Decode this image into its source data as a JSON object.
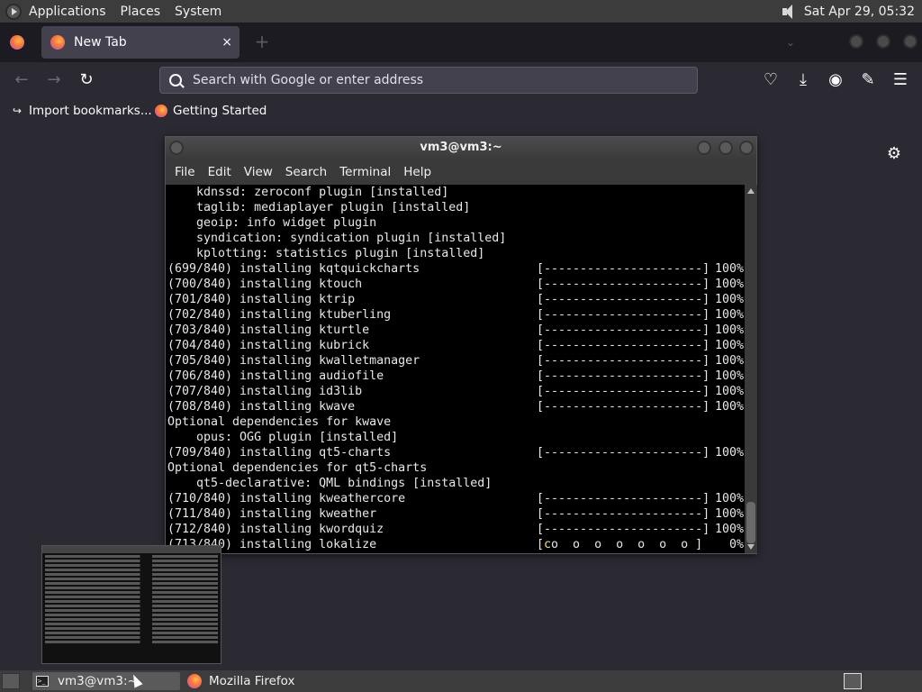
{
  "top_panel": {
    "menus": [
      "Applications",
      "Places",
      "System"
    ],
    "clock": "Sat Apr 29, 05:32"
  },
  "browser": {
    "tab": {
      "label": "New Tab",
      "close": "×"
    },
    "new_tab": "+",
    "url_placeholder": "Search with Google or enter address",
    "bookmarks": [
      "Import bookmarks...",
      "Getting Started"
    ],
    "nav": {
      "back": "←",
      "forward": "→",
      "reload": "↻"
    },
    "toolbar_icons": [
      "pocket-icon",
      "download-icon",
      "account-icon",
      "extensions-icon",
      "menu-icon"
    ]
  },
  "terminal": {
    "title": "vm3@vm3:~",
    "menu": [
      "File",
      "Edit",
      "View",
      "Search",
      "Terminal",
      "Help"
    ],
    "lines": [
      {
        "text": "    kdnssd: zeroconf plugin [installed]"
      },
      {
        "text": "    taglib: mediaplayer plugin [installed]"
      },
      {
        "text": "    geoip: info widget plugin"
      },
      {
        "text": "    syndication: syndication plugin [installed]"
      },
      {
        "text": "    kplotting: statistics plugin [installed]"
      },
      {
        "text": "(699/840) installing kqtquickcharts",
        "bar": "[----------------------]",
        "pct": "100%"
      },
      {
        "text": "(700/840) installing ktouch",
        "bar": "[----------------------]",
        "pct": "100%"
      },
      {
        "text": "(701/840) installing ktrip",
        "bar": "[----------------------]",
        "pct": "100%"
      },
      {
        "text": "(702/840) installing ktuberling",
        "bar": "[----------------------]",
        "pct": "100%"
      },
      {
        "text": "(703/840) installing kturtle",
        "bar": "[----------------------]",
        "pct": "100%"
      },
      {
        "text": "(704/840) installing kubrick",
        "bar": "[----------------------]",
        "pct": "100%"
      },
      {
        "text": "(705/840) installing kwalletmanager",
        "bar": "[----------------------]",
        "pct": "100%"
      },
      {
        "text": "(706/840) installing audiofile",
        "bar": "[----------------------]",
        "pct": "100%"
      },
      {
        "text": "(707/840) installing id3lib",
        "bar": "[----------------------]",
        "pct": "100%"
      },
      {
        "text": "(708/840) installing kwave",
        "bar": "[----------------------]",
        "pct": "100%"
      },
      {
        "text": "Optional dependencies for kwave"
      },
      {
        "text": "    opus: OGG plugin [installed]"
      },
      {
        "text": "(709/840) installing qt5-charts",
        "bar": "[----------------------]",
        "pct": "100%"
      },
      {
        "text": "Optional dependencies for qt5-charts"
      },
      {
        "text": "    qt5-declarative: QML bindings [installed]"
      },
      {
        "text": "(710/840) installing kweathercore",
        "bar": "[----------------------]",
        "pct": "100%"
      },
      {
        "text": "(711/840) installing kweather",
        "bar": "[----------------------]",
        "pct": "100%"
      },
      {
        "text": "(712/840) installing kwordquiz",
        "bar": "[----------------------]",
        "pct": "100%"
      },
      {
        "text": "(713/840) installing lokalize",
        "bar": "[",
        "bar_hl": "c",
        "bar_rest": "o  o  o  o  o  o  o ]",
        "pct": "  0%"
      }
    ]
  },
  "taskbar": {
    "tasks": [
      "vm3@vm3:~",
      "Mozilla Firefox"
    ]
  }
}
